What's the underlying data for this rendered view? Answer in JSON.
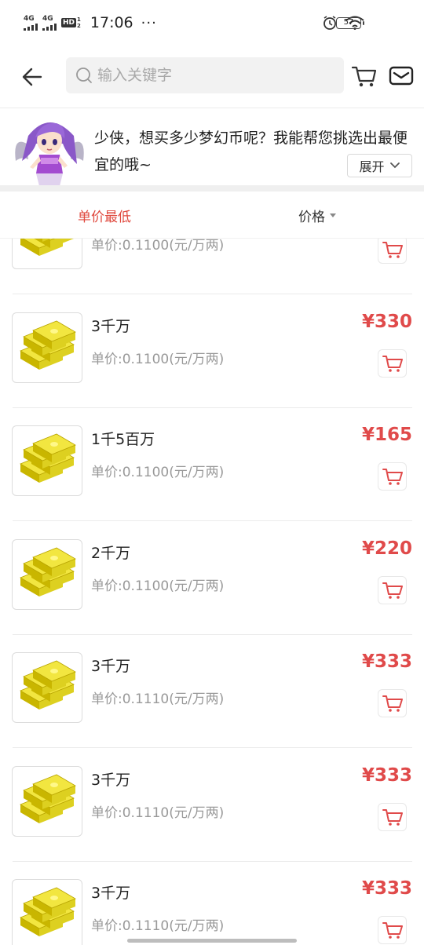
{
  "status_bar": {
    "signal1_label": "4G",
    "signal2_label": "4G",
    "hd_label": "HD",
    "hd_sub": [
      "1",
      "2"
    ],
    "time": "17:06",
    "more": "···",
    "battery": "57"
  },
  "header": {
    "search_placeholder": "输入关键字"
  },
  "banner": {
    "message": "少侠，想买多少梦幻币呢？我能帮您挑选出最便宜的哦~",
    "expand_label": "展开"
  },
  "sort": {
    "unit_price_label": "单价最低",
    "price_label": "价格"
  },
  "products": [
    {
      "name": "",
      "unit_price": "单价:0.1100(元/万两)",
      "price": ""
    },
    {
      "name": "3千万",
      "unit_price": "单价:0.1100(元/万两)",
      "price": "¥330"
    },
    {
      "name": "1千5百万",
      "unit_price": "单价:0.1100(元/万两)",
      "price": "¥165"
    },
    {
      "name": "2千万",
      "unit_price": "单价:0.1100(元/万两)",
      "price": "¥220"
    },
    {
      "name": "3千万",
      "unit_price": "单价:0.1110(元/万两)",
      "price": "¥333"
    },
    {
      "name": "3千万",
      "unit_price": "单价:0.1110(元/万两)",
      "price": "¥333"
    },
    {
      "name": "3千万",
      "unit_price": "单价:0.1110(元/万两)",
      "price": "¥333"
    }
  ],
  "colors": {
    "accent_red": "#e04a4a",
    "sort_active": "#e04a3f"
  }
}
